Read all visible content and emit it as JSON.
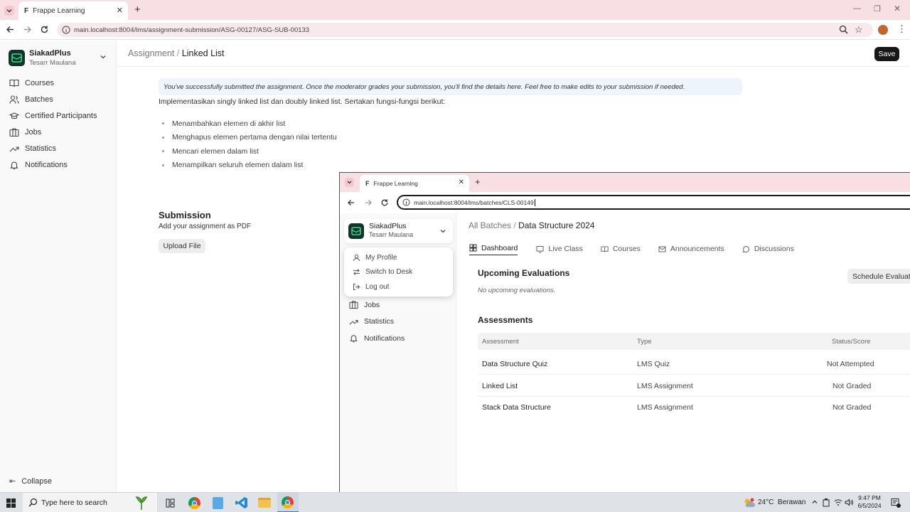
{
  "browser": {
    "tab_title": "Frappe Learning",
    "url": "main.localhost:8004/lms/assignment-submission/ASG-00127/ASG-SUB-00133"
  },
  "sidebar": {
    "app_name": "SiakadPlus",
    "user_name": "Tesarr Maulana",
    "items": [
      {
        "label": "Courses",
        "icon": "book-icon"
      },
      {
        "label": "Batches",
        "icon": "users-icon"
      },
      {
        "label": "Certified Participants",
        "icon": "graduation-cap-icon"
      },
      {
        "label": "Jobs",
        "icon": "briefcase-icon"
      },
      {
        "label": "Statistics",
        "icon": "trending-up-icon"
      },
      {
        "label": "Notifications",
        "icon": "bell-icon"
      }
    ],
    "collapse_label": "Collapse"
  },
  "header": {
    "breadcrumb_parent": "Assignment",
    "breadcrumb_sep": "/",
    "breadcrumb_current": "Linked List",
    "save_label": "Save"
  },
  "main": {
    "notice": "You've successfully submitted the assignment. Once the moderator grades your submission, you'll find the details here. Feel free to make edits to your submission if needed.",
    "description": "Implementasikan singly linked list dan doubly linked list. Sertakan fungsi-fungsi berikut:",
    "bullets": [
      "Menambahkan elemen di akhir list",
      "Menghapus elemen pertama dengan nilai tertentu",
      "Mencari elemen dalam list",
      "Menampilkan seluruh elemen dalam list"
    ],
    "submission_title": "Submission",
    "submission_subtitle": "Add your assignment as PDF",
    "upload_label": "Upload File"
  },
  "window2": {
    "tab_title": "Frappe Learning",
    "url": "main.localhost:8004/lms/batches/CLS-00149",
    "app_name": "SiakadPlus",
    "user_name": "Tesarr Maulana",
    "dropdown": [
      {
        "label": "My Profile",
        "icon": "user-icon"
      },
      {
        "label": "Switch to Desk",
        "icon": "switch-icon"
      },
      {
        "label": "Log out",
        "icon": "logout-icon"
      }
    ],
    "nav": [
      {
        "label": "Jobs",
        "icon": "briefcase-icon"
      },
      {
        "label": "Statistics",
        "icon": "trending-up-icon"
      },
      {
        "label": "Notifications",
        "icon": "bell-icon"
      }
    ],
    "breadcrumb_parent": "All Batches",
    "breadcrumb_sep": "/",
    "breadcrumb_current": "Data Structure 2024",
    "tabs": [
      {
        "label": "Dashboard",
        "icon": "dashboard-icon",
        "active": true
      },
      {
        "label": "Live Class",
        "icon": "monitor-icon"
      },
      {
        "label": "Courses",
        "icon": "book-icon"
      },
      {
        "label": "Announcements",
        "icon": "mail-icon"
      },
      {
        "label": "Discussions",
        "icon": "chat-icon"
      }
    ],
    "upcoming_title": "Upcoming Evaluations",
    "upcoming_empty": "No upcoming evaluations.",
    "schedule_label": "Schedule Evaluat",
    "assessments_title": "Assessments",
    "table_headers": [
      "Assessment",
      "Type",
      "Status/Score"
    ],
    "rows": [
      [
        "Data Structure Quiz",
        "LMS Quiz",
        "Not Attempted"
      ],
      [
        "Linked List",
        "LMS Assignment",
        "Not Graded"
      ],
      [
        "Stack Data Structure",
        "LMS Assignment",
        "Not Graded"
      ]
    ]
  },
  "taskbar": {
    "search_placeholder": "Type here to search",
    "weather": "24°C  Berawan",
    "time": "9:47 PM",
    "date": "6/5/2024"
  },
  "colors": {
    "accent": "#1f9d55",
    "tab_bg": "#f8dfe3"
  }
}
